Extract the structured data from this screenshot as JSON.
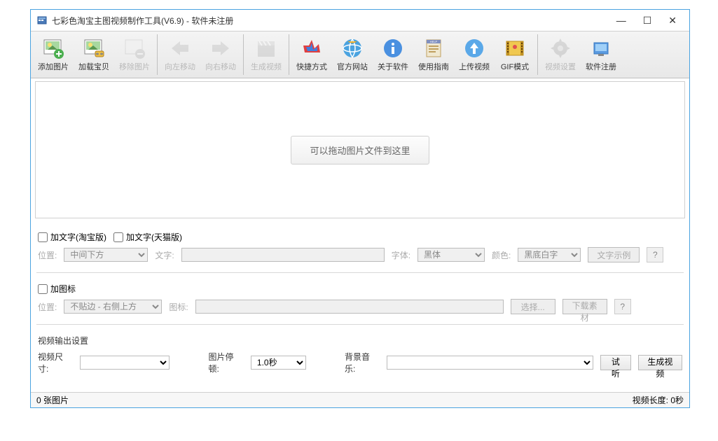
{
  "titlebar": {
    "title": "七彩色淘宝主图视频制作工具(V6.9) - 软件未注册"
  },
  "toolbar": {
    "items": [
      {
        "label": "添加图片",
        "icon": "add-image",
        "active": true
      },
      {
        "label": "加载宝贝",
        "icon": "load-item",
        "active": true
      },
      {
        "label": "移除图片",
        "icon": "remove-image",
        "active": false
      },
      {
        "label": "向左移动",
        "icon": "move-left",
        "active": false
      },
      {
        "label": "向右移动",
        "icon": "move-right",
        "active": false
      },
      {
        "label": "生成视频",
        "icon": "gen-video",
        "active": false
      },
      {
        "label": "快捷方式",
        "icon": "shortcut",
        "active": true
      },
      {
        "label": "官方网站",
        "icon": "website",
        "active": true
      },
      {
        "label": "关于软件",
        "icon": "about",
        "active": true
      },
      {
        "label": "使用指南",
        "icon": "guide",
        "active": true
      },
      {
        "label": "上传视频",
        "icon": "upload",
        "active": true
      },
      {
        "label": "GIF模式",
        "icon": "gif",
        "active": true
      },
      {
        "label": "视频设置",
        "icon": "settings",
        "active": false
      },
      {
        "label": "软件注册",
        "icon": "register",
        "active": true
      }
    ]
  },
  "drop_area": {
    "hint": "可以拖动图片文件到这里"
  },
  "text_section": {
    "checkbox_taobao": "加文字(淘宝版)",
    "checkbox_tmall": "加文字(天猫版)",
    "pos_label": "位置:",
    "pos_value": "中间下方",
    "text_label": "文字:",
    "font_label": "字体:",
    "font_value": "黑体",
    "color_label": "颜色:",
    "color_value": "黑底白字",
    "sample_btn": "文字示例",
    "help": "?"
  },
  "icon_section": {
    "checkbox": "加图标",
    "pos_label": "位置:",
    "pos_value": "不贴边 - 右侧上方",
    "icon_label": "图标:",
    "choose_btn": "选择...",
    "download_btn": "下载素材",
    "help": "?"
  },
  "output_section": {
    "title": "视频输出设置",
    "size_label": "视频尺寸:",
    "frame_label": "图片停顿:",
    "frame_value": "1.0秒",
    "music_label": "背景音乐:",
    "preview_btn": "试听",
    "gen_btn": "生成视频"
  },
  "statusbar": {
    "image_count": "0 张图片",
    "video_length": "视频长度: 0秒"
  }
}
